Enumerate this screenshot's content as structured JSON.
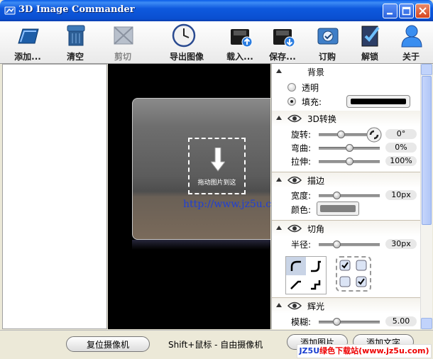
{
  "window": {
    "title": "3D Image Commander"
  },
  "toolbar": [
    {
      "label": "添加...",
      "icon": "folder-add-icon",
      "enabled": true
    },
    {
      "label": "清空",
      "icon": "clear-trash-icon",
      "enabled": true
    },
    {
      "label": "剪切",
      "icon": "crop-icon",
      "enabled": false
    },
    {
      "label": "导出图像",
      "icon": "clock-export-icon",
      "enabled": true
    },
    {
      "label": "载入...",
      "icon": "load-disk-icon",
      "enabled": true
    },
    {
      "label": "保存...",
      "icon": "save-disk-icon",
      "enabled": true
    },
    {
      "label": "订购",
      "icon": "order-icon",
      "enabled": true
    },
    {
      "label": "解锁",
      "icon": "unlock-icon",
      "enabled": true
    },
    {
      "label": "关于",
      "icon": "about-user-icon",
      "enabled": true
    }
  ],
  "canvas": {
    "drop_text": "拖动图片到这",
    "watermark": "http://www.jz5u.com"
  },
  "panel": {
    "background": {
      "title": "背景",
      "opt_transparent": "透明",
      "opt_fill": "填充:",
      "selected": "fill",
      "fill_color": "#000000"
    },
    "transform3d": {
      "title": "3D转换",
      "rows": [
        {
          "label": "旋转:",
          "value": "0°",
          "level": 0.35
        },
        {
          "label": "弯曲:",
          "value": "0%",
          "level": 0.5
        },
        {
          "label": "拉伸:",
          "value": "100%",
          "level": 0.5
        }
      ]
    },
    "stroke": {
      "title": "描边",
      "width_label": "宽度:",
      "width_value": "10px",
      "width_level": 0.3,
      "color_label": "颜色:",
      "color": "#808080"
    },
    "corner": {
      "title": "切角",
      "radius_label": "半径:",
      "radius_value": "30px",
      "radius_level": 0.3
    },
    "glow": {
      "title": "辉光",
      "blur_label": "模糊:",
      "blur_value": "5.00",
      "blur_level": 0.5
    }
  },
  "bottom": {
    "reset_camera": "复位摄像机",
    "hint": "Shift+鼠标 - 自由摄像机",
    "add_image": "添加图片",
    "add_text": "添加文字"
  },
  "site_badge": {
    "prefix": "JZ5U",
    "text": "绿色下载站(www.jz5u.com)"
  }
}
